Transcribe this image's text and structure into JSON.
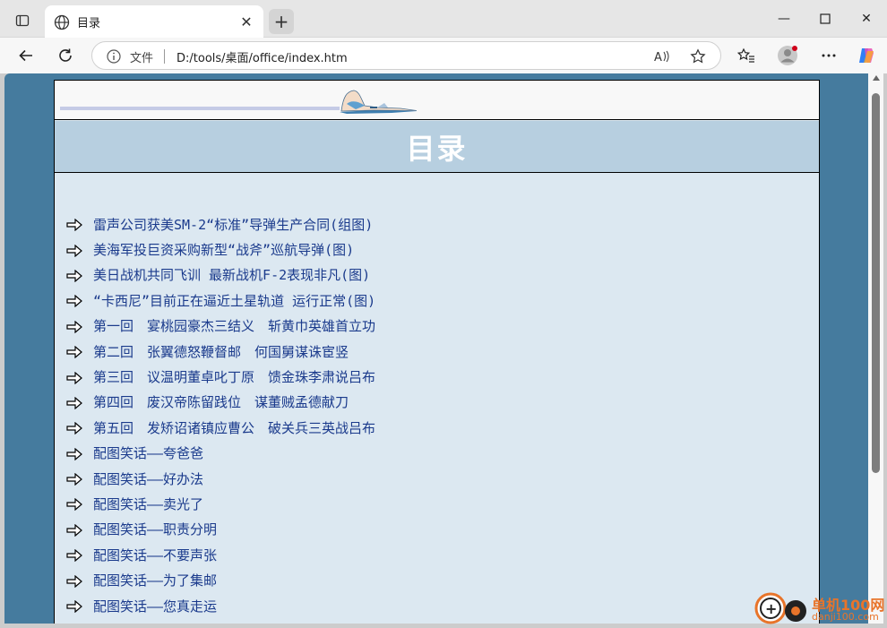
{
  "browser": {
    "tab_title": "目录",
    "address_label": "文件",
    "address_url": "D:/tools/桌面/office/index.htm"
  },
  "page": {
    "heading": "目录",
    "toc": [
      "雷声公司获美SM-2“标准”导弹生产合同(组图)",
      "美海军投巨资采购新型“战斧”巡航导弹(图)",
      "美日战机共同飞训 最新战机F-2表现非凡(图)",
      "“卡西尼”目前正在逼近土星轨道 运行正常(图)",
      "第一回　宴桃园豪杰三结义　斩黄巾英雄首立功",
      "第二回　张翼德怒鞭督邮　何国舅谋诛宦竖",
      "第三回　议温明董卓叱丁原　馈金珠李肃说吕布",
      "第四回　废汉帝陈留践位　谋董贼孟德献刀",
      "第五回　发矫诏诸镇应曹公　破关兵三英战吕布",
      "配图笑话——夸爸爸",
      "配图笑话——好办法",
      "配图笑话——卖光了",
      "配图笑话——职责分明",
      "配图笑话——不要声张",
      "配图笑话——为了集邮",
      "配图笑话——您真走运"
    ]
  },
  "watermark": {
    "line1": "单机100网",
    "line2": "danji100.com"
  }
}
